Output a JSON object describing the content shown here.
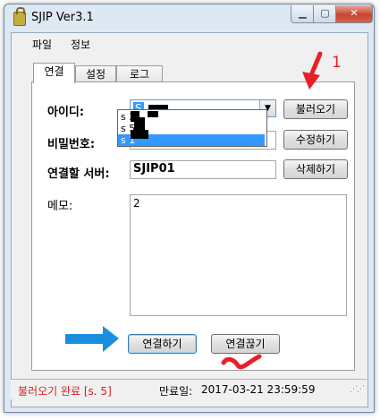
{
  "window": {
    "title": "SJIP Ver3.1",
    "min_icon": "minimize-icon",
    "max_icon": "maximize-icon",
    "close_icon": "close-icon",
    "min_glyph": "▁",
    "max_glyph": "▢",
    "close_glyph": "✕"
  },
  "menu": [
    "파일",
    "정보"
  ],
  "tabs": [
    {
      "label": "연결",
      "active": true
    },
    {
      "label": "설정",
      "active": false
    },
    {
      "label": "로그",
      "active": false
    }
  ],
  "form": {
    "id_label": "아이디:",
    "id_value": "S",
    "id_options": [
      "s   3",
      "s   5",
      "s     1"
    ],
    "id_selected_index": 2,
    "password_label": "비밀번호:",
    "server_label": "연결할 서버:",
    "server_value": "SJIP01",
    "memo_label": "메모:",
    "memo_value": "2"
  },
  "buttons": {
    "load": "불러오기",
    "edit": "수정하기",
    "delete": "삭제하기",
    "connect": "연결하기",
    "disconnect": "연결끊기"
  },
  "status": {
    "left_text": "불러오기 완료 [s.          5]",
    "expiry_label": "만료일:",
    "expiry_value": "2017-03-21 23:59:59"
  },
  "annotations": {
    "step1": "1",
    "step2": "2"
  },
  "colors": {
    "annotation_red": "#e8202a",
    "annotation_blue": "#1a8fe0",
    "selection_blue": "#3399ff",
    "status_red": "#d92020"
  }
}
